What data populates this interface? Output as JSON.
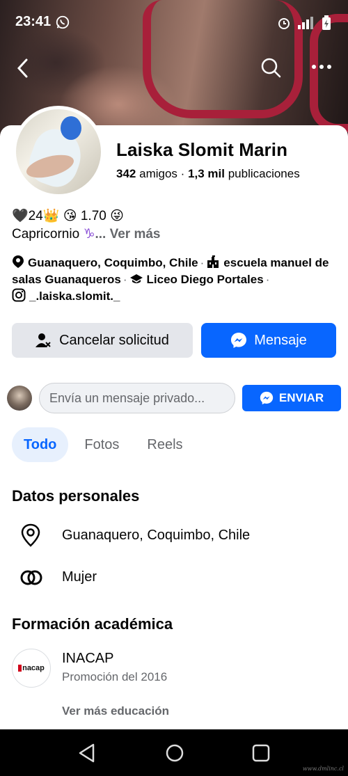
{
  "status_bar": {
    "time": "23:41"
  },
  "profile": {
    "name": "Laiska Slomit Marin",
    "friends_count": "342",
    "friends_label": "amigos",
    "posts_count": "1,3 mil",
    "posts_label": "publicaciones"
  },
  "bio": {
    "line1_a": "24",
    "line1_b": "1.70",
    "line2": "Capricornio",
    "more": "... Ver más"
  },
  "details": {
    "location": "Guanaquero, Coquimbo, Chile",
    "school1": "escuela manuel de salas Guanaqueros",
    "school2": "Liceo Diego Portales",
    "instagram": "_.laiska.slomit._"
  },
  "actions": {
    "cancel_label": "Cancelar solicitud",
    "message_label": "Mensaje"
  },
  "message_bar": {
    "placeholder": "Envía un mensaje privado...",
    "send_label": "ENVIAR"
  },
  "tabs": [
    {
      "label": "Todo",
      "active": true
    },
    {
      "label": "Fotos",
      "active": false
    },
    {
      "label": "Reels",
      "active": false
    }
  ],
  "personal": {
    "title": "Datos personales",
    "location": "Guanaquero, Coquimbo, Chile",
    "gender": "Mujer"
  },
  "education": {
    "title": "Formación académica",
    "logo_text": "nacap",
    "school": "INACAP",
    "year": "Promoción del 2016",
    "more": "Ver más educación"
  },
  "watermark": "www.dmlinc.cl",
  "colors": {
    "accent": "#0866ff",
    "secondary_text": "#65676b",
    "button_gray": "#e4e6eb"
  }
}
